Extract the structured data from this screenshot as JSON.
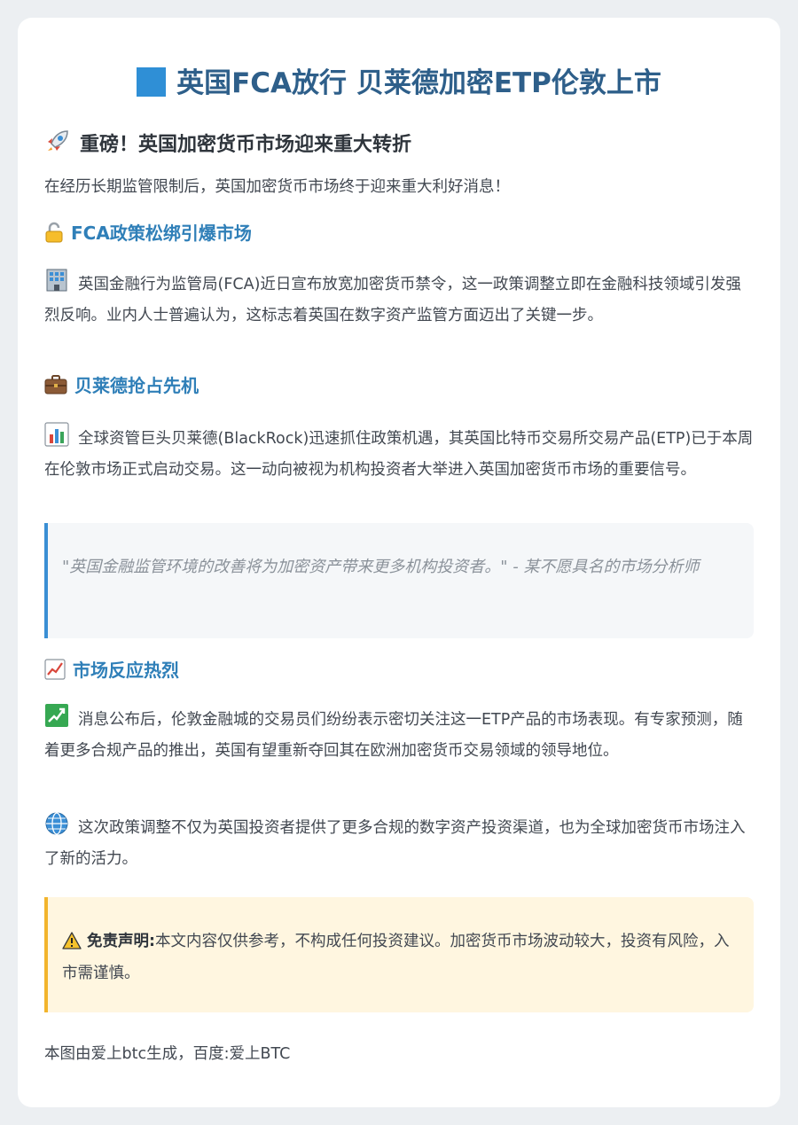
{
  "header": {
    "title": "英国FCA放行 贝莱德加密ETP伦敦上市",
    "icon": "blue-square-icon"
  },
  "headline": {
    "text": "重磅！英国加密货币市场迎来重大转折",
    "icon": "rocket-icon"
  },
  "intro": "在经历长期监管限制后，英国加密货币市场终于迎来重大利好消息！",
  "sections": [
    {
      "heading": "FCA政策松绑引爆市场",
      "heading_icon": "unlock-icon",
      "body": "英国金融行为监管局(FCA)近日宣布放宽加密货币禁令，这一政策调整立即在金融科技领域引发强烈反响。业内人士普遍认为，这标志着英国在数字资产监管方面迈出了关键一步。",
      "body_icon": "office-building-icon"
    },
    {
      "heading": "贝莱德抢占先机",
      "heading_icon": "briefcase-icon",
      "body": "全球资管巨头贝莱德(BlackRock)迅速抓住政策机遇，其英国比特币交易所交易产品(ETP)已于本周在伦敦市场正式启动交易。这一动向被视为机构投资者大举进入英国加密货币市场的重要信号。",
      "body_icon": "bar-chart-icon"
    },
    {
      "heading": "市场反应热烈",
      "heading_icon": "chart-increasing-icon",
      "body": "消息公布后，伦敦金融城的交易员们纷纷表示密切关注这一ETP产品的市场表现。有专家预测，随着更多合规产品的推出，英国有望重新夺回其在欧洲加密货币交易领域的领导地位。",
      "body_icon": "chart-yen-up-icon"
    }
  ],
  "quote": "\"英国金融监管环境的改善将为加密资产带来更多机构投资者。\" - 某不愿具名的市场分析师",
  "closing": {
    "text": "这次政策调整不仅为英国投资者提供了更多合规的数字资产投资渠道，也为全球加密货币市场注入了新的活力。",
    "icon": "globe-icon"
  },
  "disclaimer": {
    "label": "免责声明:",
    "text": "本文内容仅供参考，不构成任何投资建议。加密货币市场波动较大，投资有风险，入市需谨慎。",
    "icon": "warning-icon"
  },
  "footer": "本图由爱上btc生成，百度:爱上BTC",
  "colors": {
    "accent": "#2f7fb8",
    "quote_border": "#3a8fd4",
    "warning_border": "#f2b42c",
    "warning_bg": "#fff6e0"
  }
}
